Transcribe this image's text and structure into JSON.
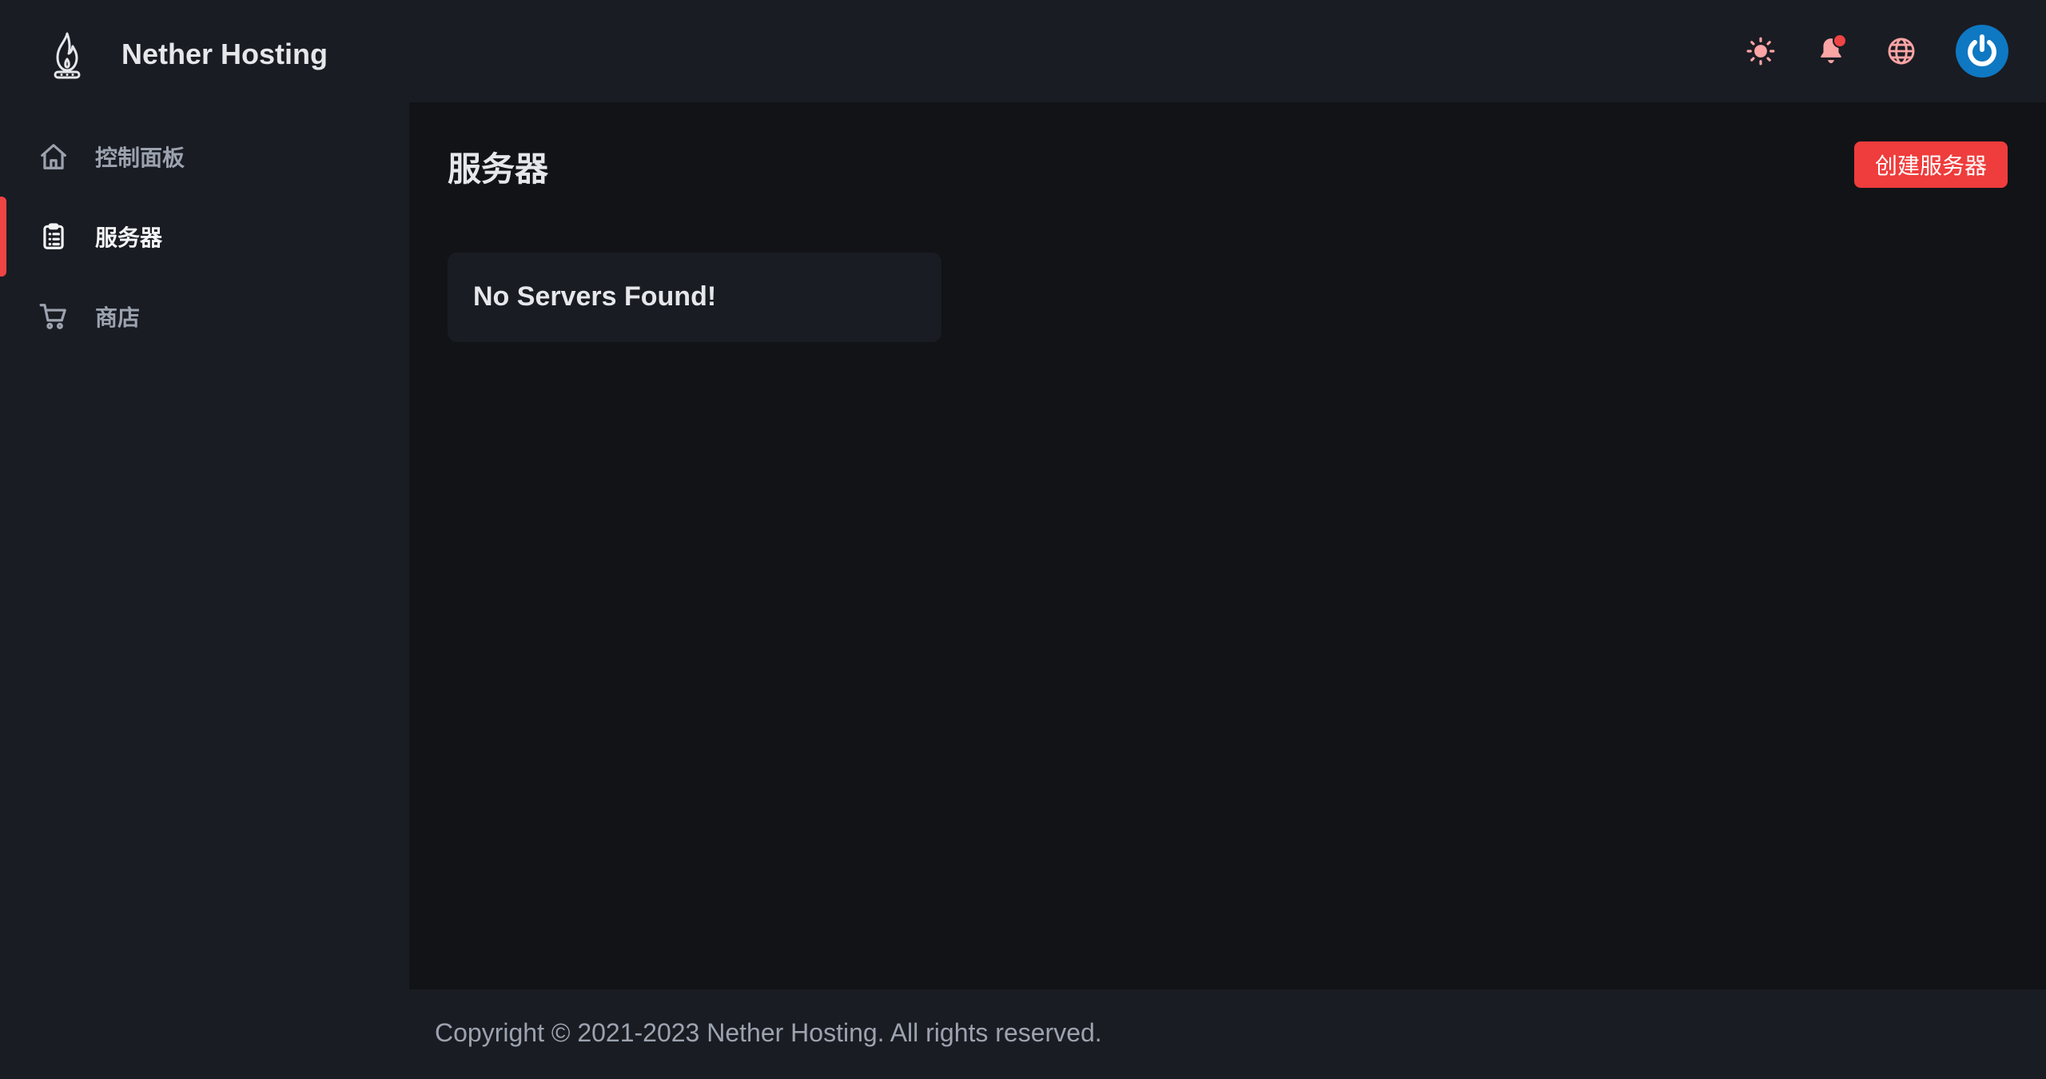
{
  "header": {
    "brand": "Nether Hosting",
    "icons": [
      "flame-logo-icon",
      "sun-icon",
      "bell-icon",
      "globe-icon",
      "power-icon"
    ],
    "notification_dot_color": "#ef4444",
    "avatar_color": "#0e78c2"
  },
  "sidebar": {
    "items": [
      {
        "label": "控制面板",
        "icon": "home-icon",
        "active": false
      },
      {
        "label": "服务器",
        "icon": "clipboard-list-icon",
        "active": true
      },
      {
        "label": "商店",
        "icon": "cart-icon",
        "active": false
      }
    ],
    "active_indicator_color": "#ef4444"
  },
  "main": {
    "title": "服务器",
    "create_button_label": "创建服务器",
    "create_button_color": "#ef3c3c",
    "empty_message": "No Servers Found!"
  },
  "footer": {
    "copyright": "Copyright © 2021-2023 Nether Hosting. All rights reserved."
  }
}
